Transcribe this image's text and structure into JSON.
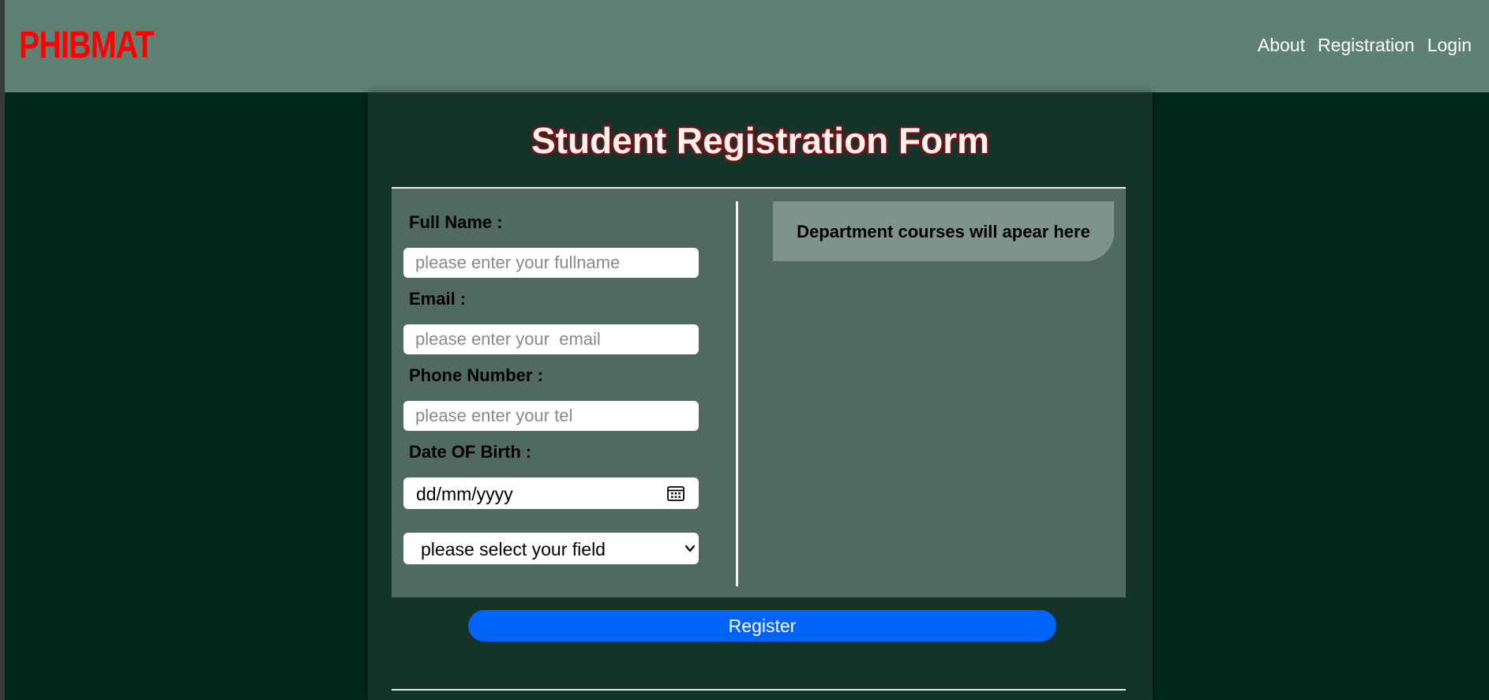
{
  "navbar": {
    "logo": "PHIBMAT",
    "links": [
      "About",
      "Registration",
      "Login"
    ]
  },
  "form": {
    "title": "Student Registration Form",
    "fields": {
      "fullname": {
        "label": "Full Name :",
        "placeholder": "please enter your fullname"
      },
      "email": {
        "label": "Email :",
        "placeholder": "please enter your  email"
      },
      "phone": {
        "label": "Phone Number :",
        "placeholder": "please enter your tel"
      },
      "dob": {
        "label": "Date OF Birth :",
        "value": "dd/mm/yyyy"
      }
    },
    "select": {
      "selected": "please select your field"
    },
    "courses_placeholder": "Department courses will apear here",
    "register_label": "Register"
  },
  "colors": {
    "navbar": "#5f8173",
    "background": "#00281c",
    "panel": "#14332b",
    "form_area": "#506962",
    "courses_box": "#7f938d",
    "logo": "#ff0000",
    "button": "#0063fb"
  },
  "icons": {
    "date": "calendar-icon",
    "select": "chevron-down-icon"
  }
}
